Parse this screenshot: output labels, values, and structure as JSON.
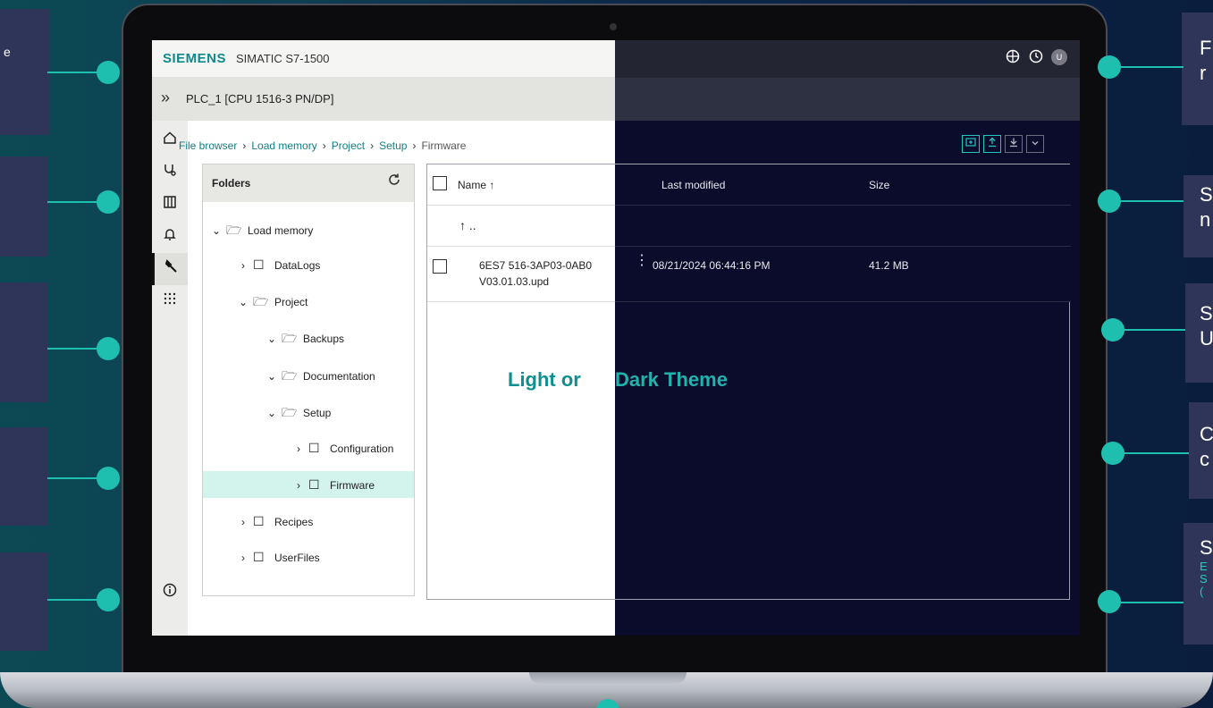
{
  "header": {
    "brand": "SIEMENS",
    "product": "SIMATIC S7-1500",
    "user_initial": "U",
    "icons": [
      "globe-icon",
      "clock-icon",
      "user-icon"
    ]
  },
  "device": {
    "expand_glyph": "»",
    "name": "PLC_1 [CPU 1516-3 PN/DP]"
  },
  "breadcrumb": {
    "items": [
      "File browser",
      "Load memory",
      "Project",
      "Setup"
    ],
    "current": "Firmware",
    "separator": "›"
  },
  "folders": {
    "title": "Folders",
    "tree": [
      {
        "label": "Load memory",
        "expanded": true
      },
      {
        "label": "DataLogs",
        "expanded": false
      },
      {
        "label": "Project",
        "expanded": true
      },
      {
        "label": "Backups",
        "expanded": true
      },
      {
        "label": "Documentation",
        "expanded": true
      },
      {
        "label": "Setup",
        "expanded": true
      },
      {
        "label": "Configuration",
        "expanded": false
      },
      {
        "label": "Firmware",
        "expanded": false,
        "selected": true
      },
      {
        "label": "Recipes",
        "expanded": false
      },
      {
        "label": "UserFiles",
        "expanded": false
      }
    ]
  },
  "files": {
    "columns": {
      "name": "Name ↑",
      "modified": "Last modified",
      "size": "Size"
    },
    "parent_row": "↑  ..",
    "rows": [
      {
        "name_line1": "6ES7 516-3AP03-0AB0",
        "name_line2": "V03.01.03.upd",
        "modified": "08/21/2024 06:44:16 PM",
        "size": "41.2 MB"
      }
    ]
  },
  "theme_label": {
    "light_part": "Light or ",
    "dark_part": "Dark Theme"
  },
  "side_cards": {
    "left": [
      "e"
    ],
    "right": [
      {
        "line1": "F",
        "line2": "r"
      },
      {
        "line1": "S",
        "line2": "n"
      },
      {
        "line1": "S",
        "line2": "U"
      },
      {
        "line1": "C",
        "line2": "c"
      },
      {
        "line1": "S",
        "sub1": "E",
        "sub2": "S",
        "sub3": "("
      }
    ]
  },
  "colors": {
    "accent": "#1fbfb0",
    "brand": "#0f8a8c",
    "dark_bg": "#0b0b2b",
    "light_bg": "#ffffff",
    "selected_row": "#d2f4ec"
  }
}
